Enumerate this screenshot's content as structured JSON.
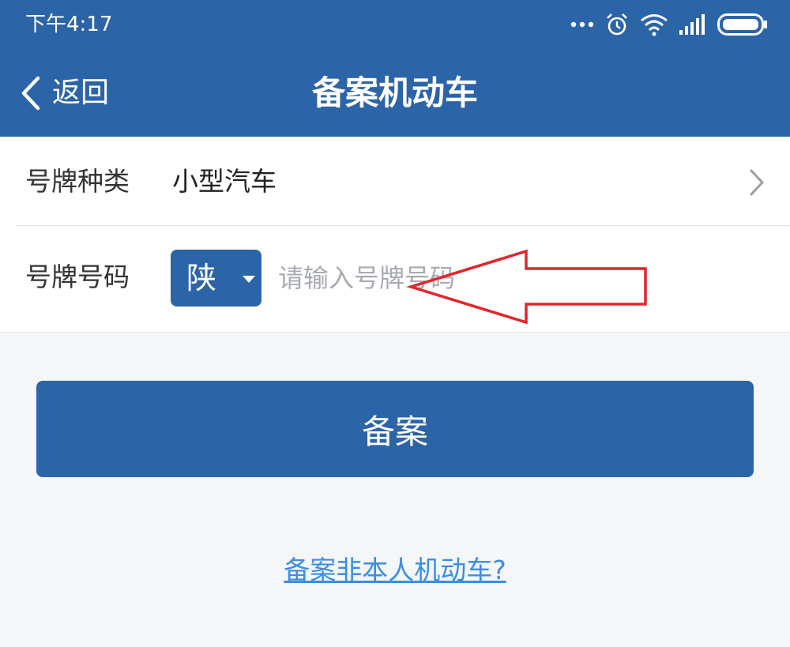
{
  "status_bar": {
    "time": "下午4:17",
    "icons": [
      "more-dots-icon",
      "alarm-icon",
      "wifi-icon",
      "signal-icon",
      "battery-icon"
    ]
  },
  "nav": {
    "back_label": "返回",
    "title": "备案机动车"
  },
  "form": {
    "plate_type": {
      "label": "号牌种类",
      "value": "小型汽车"
    },
    "plate_number": {
      "label": "号牌号码",
      "province": "陕",
      "placeholder": "请输入号牌号码",
      "value": ""
    }
  },
  "submit_label": "备案",
  "other_vehicle_link": "备案非本人机动车?",
  "colors": {
    "primary": "#2c64a8",
    "background": "#f4f6f8",
    "link": "#3c8ee0",
    "annotation": "#e3242b"
  }
}
